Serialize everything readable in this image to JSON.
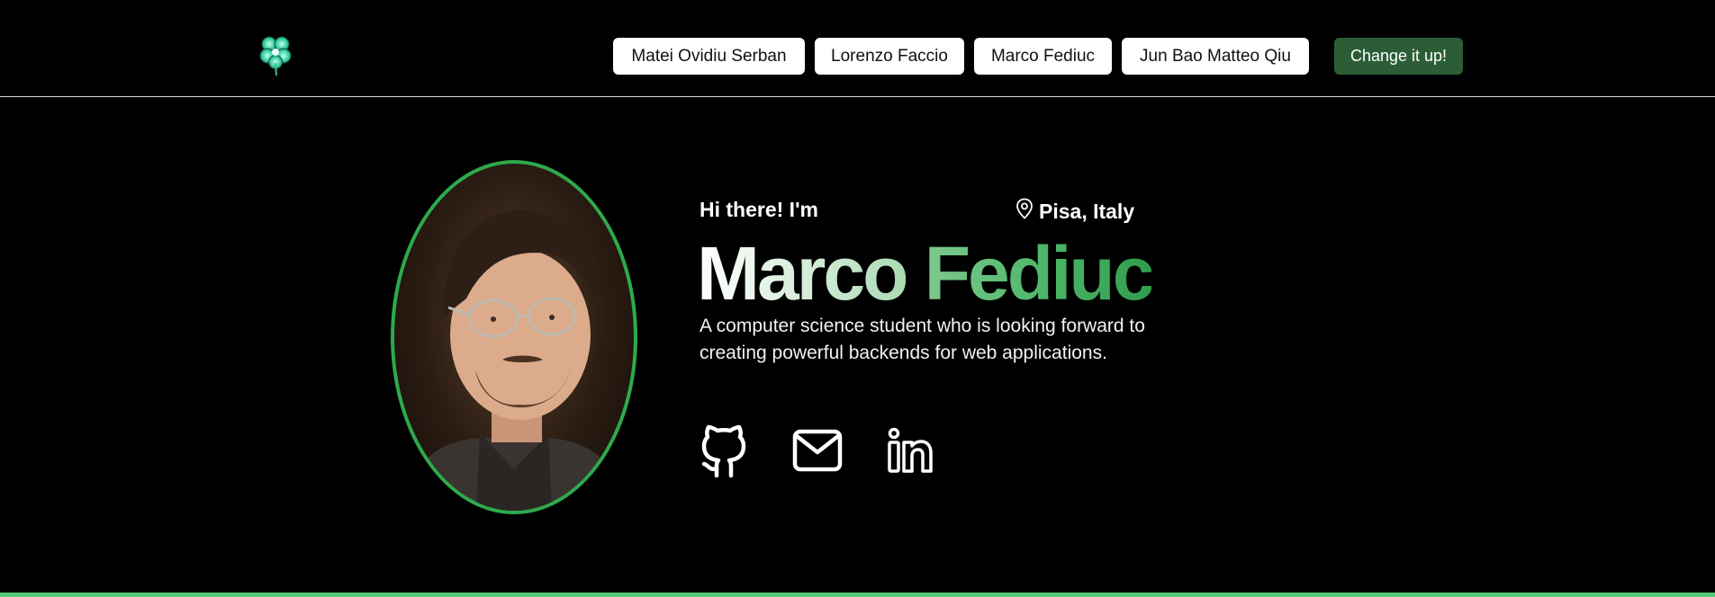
{
  "nav": {
    "items": [
      {
        "label": "Matei Ovidiu Serban"
      },
      {
        "label": "Lorenzo Faccio"
      },
      {
        "label": "Marco Fediuc"
      },
      {
        "label": "Jun Bao Matteo Qiu"
      }
    ],
    "cta_label": "Change it up!"
  },
  "hero": {
    "greeting": "Hi there! I'm",
    "location": "Pisa, Italy",
    "first_name": "Marco",
    "last_name": "Fediuc",
    "tagline": "A computer science student who is looking forward to creating powerful backends for web applications."
  },
  "social": {
    "icons": [
      "github-icon",
      "mail-icon",
      "linkedin-icon"
    ]
  },
  "colors": {
    "background": "#000000",
    "accent_green": "#2eaa4c",
    "cta_green": "#2b5e36",
    "bottom_bar": "#59c879"
  }
}
